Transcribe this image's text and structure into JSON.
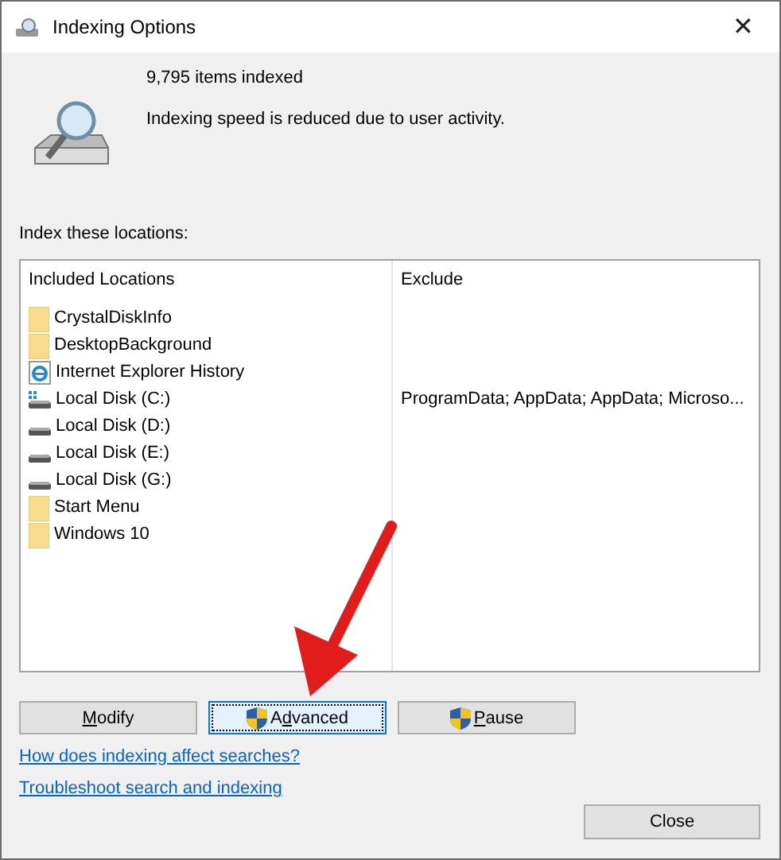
{
  "window": {
    "title": "Indexing Options",
    "close": "✕"
  },
  "status": {
    "items_indexed": "9,795 items indexed",
    "message": "Indexing speed is reduced due to user activity."
  },
  "locations_label": "Index these locations:",
  "table": {
    "columns": [
      "Included Locations",
      "Exclude"
    ],
    "rows": [
      {
        "kind": "folder",
        "location": "CrystalDiskInfo"
      },
      {
        "kind": "folder",
        "location": "DesktopBackground"
      },
      {
        "kind": "browser",
        "location": "Internet Explorer History"
      },
      {
        "kind": "system-disk",
        "location": "Local Disk (C:)",
        "exclude": "ProgramData; AppData; AppData; Microso..."
      },
      {
        "kind": "disk",
        "location": "Local Disk (D:)"
      },
      {
        "kind": "disk",
        "location": "Local Disk (E:)"
      },
      {
        "kind": "disk",
        "location": "Local Disk (G:)"
      },
      {
        "kind": "folder",
        "location": "Start Menu"
      },
      {
        "kind": "folder",
        "location": "Windows 10"
      }
    ]
  },
  "buttons": [
    {
      "label": {
        "access_key": "M",
        "rest": "odify"
      },
      "shield": false,
      "focused": false
    },
    {
      "label": {
        "before": "A",
        "access_key": "d",
        "rest": "vanced"
      },
      "shield": true,
      "focused": true
    },
    {
      "label": {
        "access_key": "P",
        "rest": "ause"
      },
      "shield": true,
      "focused": false
    }
  ],
  "links": [
    "How does indexing affect searches?",
    "Troubleshoot search and indexing"
  ],
  "close_button": "Close",
  "annotation": {
    "kind": "arrow"
  }
}
